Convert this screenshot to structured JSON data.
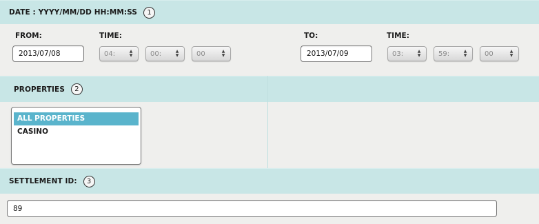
{
  "date_section": {
    "heading": "DATE : YYYY/MM/DD HH:MM:SS",
    "step": "1",
    "from_label": "FROM:",
    "from_date": "2013/07/08",
    "from_time_label": "TIME:",
    "from_hour": "04:",
    "from_minute": "00:",
    "from_second": "00",
    "to_label": "TO:",
    "to_date": "2013/07/09",
    "to_time_label": "TIME:",
    "to_hour": "03:",
    "to_minute": "59:",
    "to_second": "00"
  },
  "properties_section": {
    "heading": "PROPERTIES",
    "step": "2",
    "options": [
      "ALL PROPERTIES",
      "CASINO"
    ],
    "selected": "ALL PROPERTIES"
  },
  "settlement_section": {
    "heading": "SETTLEMENT ID:",
    "step": "3",
    "value": "89"
  },
  "colors": {
    "band": "#c8e6e6",
    "selection": "#5ab4cc"
  }
}
